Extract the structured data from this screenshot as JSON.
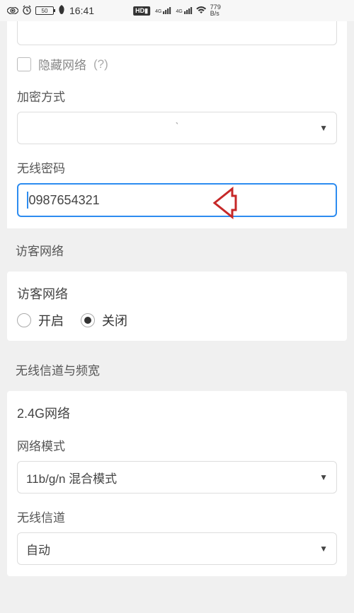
{
  "status_bar": {
    "hd": "HD",
    "net_type": "4G",
    "speed_top": "779",
    "speed_bottom": "B/s",
    "battery": "50",
    "time": "16:41"
  },
  "section1": {
    "hidden_network": "隐藏网络",
    "help": "(?)",
    "encrypt_label": "加密方式",
    "encrypt_ghost": "ˋ",
    "password_label": "无线密码",
    "password_value": "0987654321"
  },
  "section2": {
    "title": "访客网络",
    "label": "访客网络",
    "radio_on": "开启",
    "radio_off": "关闭"
  },
  "section3": {
    "title": "无线信道与频宽",
    "band_title": "2.4G网络",
    "mode_label": "网络模式",
    "mode_value": "11b/g/n 混合模式",
    "channel_label": "无线信道",
    "channel_value": "自动"
  }
}
